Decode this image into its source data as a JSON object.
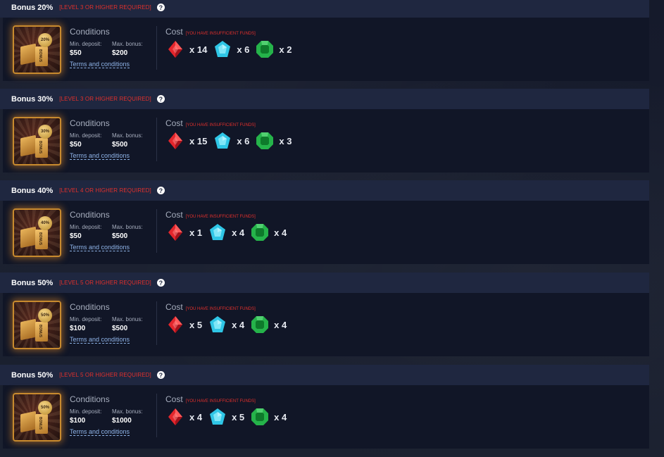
{
  "common": {
    "conditions_label": "Conditions",
    "min_deposit_label": "Min. deposit:",
    "max_bonus_label": "Max. bonus:",
    "terms_label": "Terms and conditions",
    "cost_label": "Cost",
    "insufficient_label": "[YOU HAVE INSUFFICIENT FUNDS]",
    "help_glyph": "?",
    "image_side_text": "BONUS",
    "gem_prefix": "x"
  },
  "colors": {
    "header_bg": "#1f2740",
    "body_bg": "#111627",
    "requirement_red": "#e0302c",
    "link_blue": "#8fb4e8",
    "ruby": "#e3262c",
    "sapphire": "#2fc6e6",
    "emerald": "#25b34a"
  },
  "offers": [
    {
      "title": "Bonus 20%",
      "requirement": "[LEVEL 3 OR HIGHER REQUIRED]",
      "badge": "20%",
      "min_deposit": "$50",
      "max_bonus": "$200",
      "cost": {
        "red": "x 14",
        "blue": "x 6",
        "green": "x 2"
      }
    },
    {
      "title": "Bonus 30%",
      "requirement": "[LEVEL 3 OR HIGHER REQUIRED]",
      "badge": "30%",
      "min_deposit": "$50",
      "max_bonus": "$500",
      "cost": {
        "red": "x 15",
        "blue": "x 6",
        "green": "x 3"
      }
    },
    {
      "title": "Bonus 40%",
      "requirement": "[LEVEL 4 OR HIGHER REQUIRED]",
      "badge": "40%",
      "min_deposit": "$50",
      "max_bonus": "$500",
      "cost": {
        "red": "x 1",
        "blue": "x 4",
        "green": "x 4"
      }
    },
    {
      "title": "Bonus 50%",
      "requirement": "[LEVEL 5 OR HIGHER REQUIRED]",
      "badge": "50%",
      "min_deposit": "$100",
      "max_bonus": "$500",
      "cost": {
        "red": "x 5",
        "blue": "x 4",
        "green": "x 4"
      }
    },
    {
      "title": "Bonus 50%",
      "requirement": "[LEVEL 5 OR HIGHER REQUIRED]",
      "badge": "50%",
      "min_deposit": "$100",
      "max_bonus": "$1000",
      "cost": {
        "red": "x 4",
        "blue": "x 5",
        "green": "x 4"
      }
    }
  ]
}
